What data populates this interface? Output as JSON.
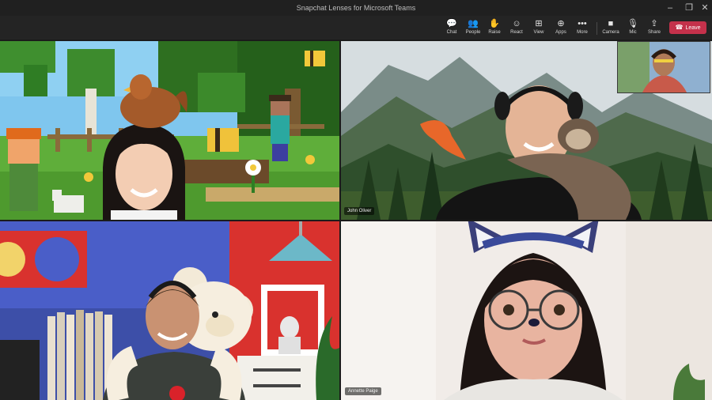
{
  "window": {
    "title": "Snapchat Lenses for Microsoft Teams"
  },
  "window_controls": [
    {
      "name": "minimize",
      "glyph": "–"
    },
    {
      "name": "maximize",
      "glyph": "❐"
    },
    {
      "name": "close",
      "glyph": "✕"
    }
  ],
  "toolbar": {
    "items": [
      {
        "id": "chat",
        "label": "Chat",
        "icon": "chat-icon",
        "glyph": "💬"
      },
      {
        "id": "people",
        "label": "People",
        "icon": "people-icon",
        "glyph": "👥"
      },
      {
        "id": "raise",
        "label": "Raise",
        "icon": "hand-icon",
        "glyph": "✋"
      },
      {
        "id": "react",
        "label": "React",
        "icon": "smiley-icon",
        "glyph": "☺"
      },
      {
        "id": "view",
        "label": "View",
        "icon": "grid-icon",
        "glyph": "⊞"
      },
      {
        "id": "apps",
        "label": "Apps",
        "icon": "apps-icon",
        "glyph": "⊕"
      },
      {
        "id": "more",
        "label": "More",
        "icon": "more-icon",
        "glyph": "•••"
      },
      {
        "id": "camera",
        "label": "Camera",
        "icon": "camera-icon",
        "glyph": "■"
      },
      {
        "id": "mic",
        "label": "Mic",
        "icon": "mic-icon",
        "glyph": "🎙"
      },
      {
        "id": "share",
        "label": "Share",
        "icon": "share-icon",
        "glyph": "⇪"
      }
    ],
    "leave_label": "Leave",
    "leave_color": "#c4314b"
  },
  "participants": [
    {
      "id": "top-left",
      "name": ""
    },
    {
      "id": "top-right",
      "name": "John Oliver"
    },
    {
      "id": "bottom-left",
      "name": ""
    },
    {
      "id": "bottom-right",
      "name": "Annette Paige"
    },
    {
      "id": "self-view",
      "name": ""
    }
  ]
}
